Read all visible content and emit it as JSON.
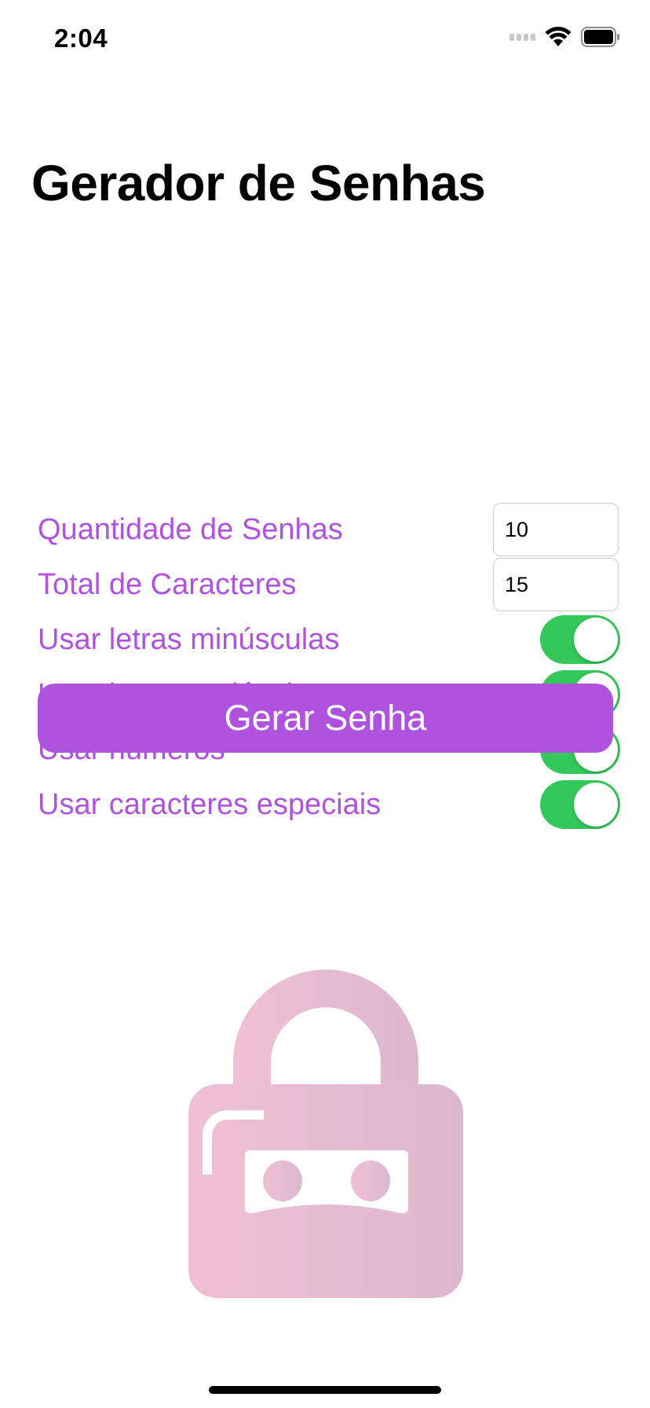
{
  "status_bar": {
    "time": "2:04"
  },
  "title": "Gerador de Senhas",
  "fields": [
    {
      "label": "Quantidade de Senhas",
      "value": "10"
    },
    {
      "label": "Total de Caracteres",
      "value": "15"
    }
  ],
  "toggles": [
    {
      "label": "Usar letras minúsculas",
      "on": true
    },
    {
      "label": "Usar letras maiúculas",
      "on": true
    },
    {
      "label": "Usar números",
      "on": true
    },
    {
      "label": "Usar caracteres especiais",
      "on": true
    }
  ],
  "button": {
    "label": "Gerar Senha"
  },
  "colors": {
    "accent": "#af52de",
    "toggle_on": "#34c759",
    "lock_gradient_start": "#f0bfd5",
    "lock_gradient_end": "#dcb8cd"
  },
  "icons": {
    "lock": "ninja-lock-icon"
  }
}
